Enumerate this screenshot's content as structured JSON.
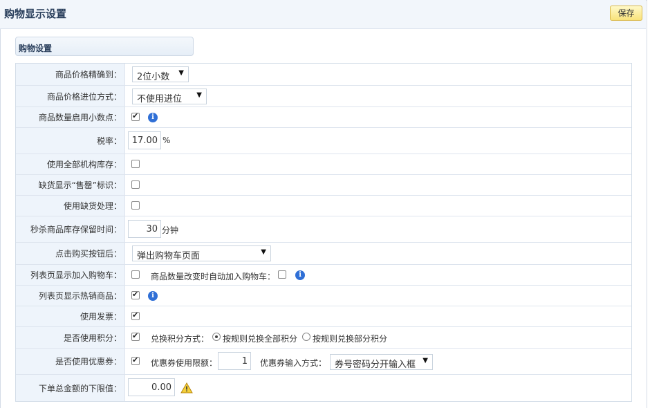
{
  "header": {
    "title": "购物显示设置",
    "save_label": "保存"
  },
  "section": {
    "title": "购物设置"
  },
  "rows": {
    "price_precision": {
      "label": "商品价格精确到：",
      "value": "2位小数"
    },
    "price_rounding": {
      "label": "商品价格进位方式：",
      "value": "不使用进位"
    },
    "qty_decimal": {
      "label": "商品数量启用小数点：",
      "checked": true
    },
    "tax": {
      "label": "税率：",
      "value": "17.00",
      "unit": "%"
    },
    "all_stock": {
      "label": "使用全部机构库存：",
      "checked": false
    },
    "soldout_mark": {
      "label": "缺货显示“售罄”标识：",
      "checked": false
    },
    "oos_handle": {
      "label": "使用缺货处理：",
      "checked": false
    },
    "flash_hold": {
      "label": "秒杀商品库存保留时间：",
      "value": "30",
      "unit": "分钟"
    },
    "buy_click": {
      "label": "点击购买按钮后：",
      "value": "弹出购物车页面"
    },
    "list_add_cart": {
      "label": "列表页显示加入购物车：",
      "checked": false,
      "sub_label": "商品数量改变时自动加入购物车：",
      "sub_checked": false
    },
    "list_hot": {
      "label": "列表页显示热销商品：",
      "checked": true
    },
    "invoice": {
      "label": "使用发票：",
      "checked": true
    },
    "points": {
      "label": "是否使用积分：",
      "checked": true,
      "sub_label": "兑换积分方式：",
      "option_all": "按规则兑换全部积分",
      "option_part": "按规则兑换部分积分",
      "selected": "all"
    },
    "coupon": {
      "label": "是否使用优惠券：",
      "checked": true,
      "limit_label": "优惠券使用限额：",
      "limit_value": "1",
      "input_label": "优惠券输入方式：",
      "input_value": "券号密码分开输入框"
    },
    "min_total": {
      "label": "下单总金额的下限值：",
      "value": "0.00"
    }
  }
}
